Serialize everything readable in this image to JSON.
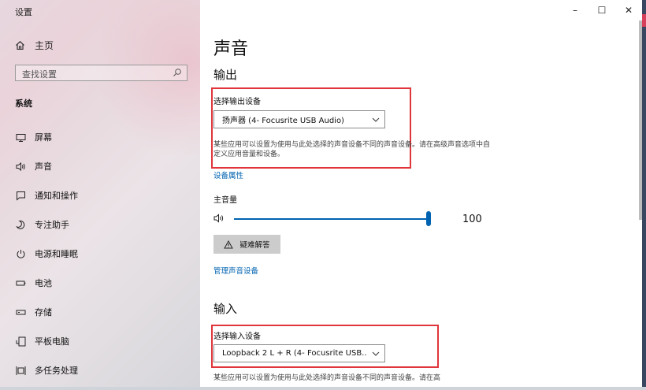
{
  "window": {
    "title": "设置",
    "controls": {
      "minimize": "–",
      "maximize": "☐",
      "close": "✕"
    }
  },
  "sidebar": {
    "home_label": "主页",
    "search_placeholder": "查找设置",
    "section_heading": "系统",
    "items": [
      {
        "label": "屏幕",
        "icon": "display-icon"
      },
      {
        "label": "声音",
        "icon": "speaker-icon"
      },
      {
        "label": "通知和操作",
        "icon": "notification-icon"
      },
      {
        "label": "专注助手",
        "icon": "moon-icon"
      },
      {
        "label": "电源和睡眠",
        "icon": "power-icon"
      },
      {
        "label": "电池",
        "icon": "battery-icon"
      },
      {
        "label": "存储",
        "icon": "storage-icon"
      },
      {
        "label": "平板电脑",
        "icon": "tablet-icon"
      },
      {
        "label": "多任务处理",
        "icon": "multitask-icon"
      }
    ]
  },
  "main": {
    "title": "声音",
    "output": {
      "heading": "输出",
      "select_label": "选择输出设备",
      "selected_device": "扬声器 (4- Focusrite USB Audio)",
      "description": "某些应用可以设置为使用与此处选择的声音设备不同的声音设备。请在高级声音选项中自定义应用音量和设备。",
      "device_properties_link": "设备属性",
      "master_volume_label": "主音量",
      "volume_value": "100",
      "volume_level": 1.0,
      "troubleshoot_label": "疑难解答",
      "manage_link": "管理声音设备"
    },
    "input": {
      "heading": "输入",
      "select_label": "选择输入设备",
      "selected_device": "Loopback 2 L + R (4- Focusrite USB...",
      "description": "某些应用可以设置为使用与此处选择的声音设备不同的声音设备。请在高"
    }
  },
  "colors": {
    "accent": "#0063b1",
    "highlight_box": "#e0353a"
  }
}
